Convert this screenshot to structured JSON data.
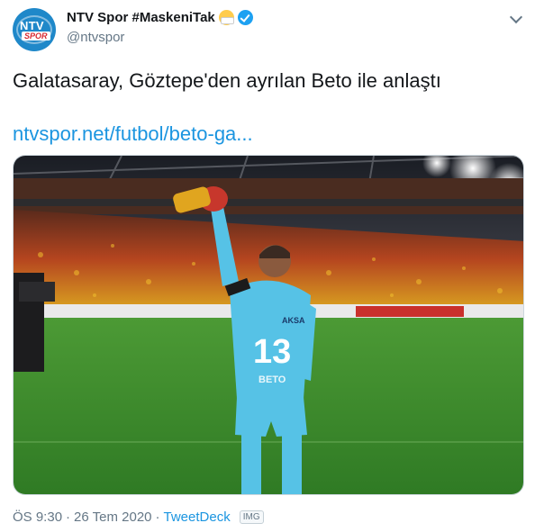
{
  "author": {
    "display_name": "NTV Spor #MaskeniTak",
    "handle": "@ntvspor",
    "avatar_text_top": "NTV",
    "avatar_text_bottom": "SPOR"
  },
  "tweet": {
    "text": "Galatasaray, Göztepe'den ayrılan Beto ile anlaştı",
    "link_text": "ntvspor.net/futbol/beto-ga..."
  },
  "photo": {
    "jersey_sponsor": "AKSA",
    "jersey_number": "13",
    "jersey_name": "BETO",
    "armband_text": "C"
  },
  "meta": {
    "time": "ÖS 9:30",
    "separator": "·",
    "date": "26 Tem 2020",
    "separator2": "·",
    "source": "TweetDeck",
    "badge": "IMG"
  },
  "icons": [
    "mask-emoji-icon",
    "verified-badge-icon",
    "chevron-down-icon"
  ],
  "colors": {
    "link": "#1b95e0",
    "verified": "#1da1f2",
    "secondary_text": "#657786",
    "pitch": "#3f8f2e",
    "jersey": "#56c2e6"
  }
}
